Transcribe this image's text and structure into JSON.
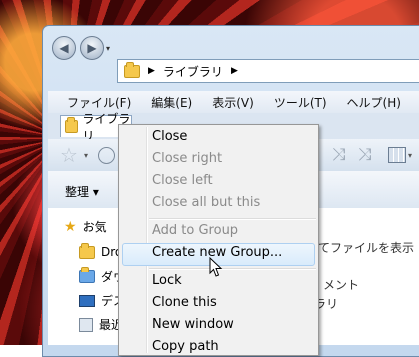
{
  "address": {
    "segments": [
      "ライブラリ"
    ]
  },
  "menubar": [
    "ファイル(F)",
    "編集(E)",
    "表示(V)",
    "ツール(T)",
    "ヘルプ(H)"
  ],
  "tab": {
    "label": "ライブラリ"
  },
  "command_bar": {
    "organize": "整理 ▾"
  },
  "tree": [
    {
      "label": "お気",
      "icon": "star-icon"
    },
    {
      "label": "Dro",
      "icon": "folder-icon"
    },
    {
      "label": "ダウ",
      "icon": "download-folder-icon"
    },
    {
      "label": "デス",
      "icon": "desktop-icon"
    },
    {
      "label": "最近",
      "icon": "recent-icon"
    }
  ],
  "content_text": {
    "line1": "てファイルを表示",
    "line2": "メント",
    "line3": "ラリ"
  },
  "context_menu": {
    "items": [
      {
        "label": "Close",
        "enabled": true
      },
      {
        "label": "Close right",
        "enabled": false
      },
      {
        "label": "Close left",
        "enabled": false
      },
      {
        "label": "Close all but this",
        "enabled": false
      },
      {
        "label": "Add to Group",
        "enabled": false
      },
      {
        "label": "Create new Group...",
        "enabled": true,
        "hover": true
      },
      {
        "label": "Lock",
        "enabled": true
      },
      {
        "label": "Clone this",
        "enabled": true
      },
      {
        "label": "New window",
        "enabled": true
      },
      {
        "label": "Copy path",
        "enabled": true
      }
    ]
  }
}
